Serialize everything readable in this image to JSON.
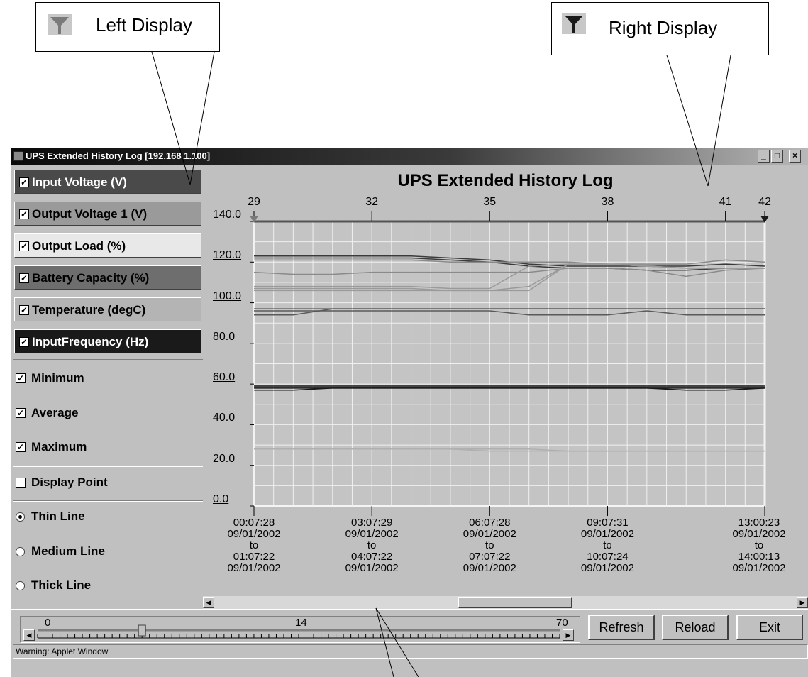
{
  "callouts": {
    "left": "Left Display",
    "right": "Right Display"
  },
  "window": {
    "title": "UPS Extended History Log [192.168.1.100]",
    "controls": {
      "minimize": "_",
      "maximize": "□",
      "close": "×"
    }
  },
  "series_panel": {
    "items": [
      {
        "label": "Input Voltage (V)",
        "checked": true,
        "bg": "#4a4a4a",
        "fg": "#ffffff"
      },
      {
        "label": "Output Voltage 1 (V)",
        "checked": true,
        "bg": "#9a9a9a",
        "fg": "#000000"
      },
      {
        "label": "Output Load (%)",
        "checked": true,
        "bg": "#e8e8e8",
        "fg": "#000000"
      },
      {
        "label": "Battery Capacity (%)",
        "checked": true,
        "bg": "#6e6e6e",
        "fg": "#000000"
      },
      {
        "label": "Temperature (degC)",
        "checked": true,
        "bg": "#b4b4b4",
        "fg": "#000000"
      },
      {
        "label": "InputFrequency (Hz)",
        "checked": true,
        "bg": "#1a1a1a",
        "fg": "#ffffff"
      }
    ],
    "stats": [
      {
        "label": "Minimum",
        "checked": true
      },
      {
        "label": "Average",
        "checked": true
      },
      {
        "label": "Maximum",
        "checked": true
      }
    ],
    "display_point": {
      "label": "Display Point",
      "checked": false
    },
    "line_widths": [
      {
        "label": "Thin Line",
        "selected": true
      },
      {
        "label": "Medium Line",
        "selected": false
      },
      {
        "label": "Thick Line",
        "selected": false
      }
    ]
  },
  "chart_data": {
    "type": "line",
    "title": "UPS Extended History Log",
    "y_ticks": [
      "140.0",
      "120.0",
      "100.0",
      "80.0",
      "60.0",
      "40.0",
      "20.0",
      "0.0"
    ],
    "ylim": [
      0,
      140
    ],
    "top_ticks": [
      "29",
      "32",
      "35",
      "38",
      "41",
      "42"
    ],
    "top_tick_values": [
      29,
      32,
      35,
      38,
      41,
      42
    ],
    "xlim": [
      29,
      42
    ],
    "bottom_labels": [
      {
        "x": 29,
        "lines": [
          "00:07:28",
          "09/01/2002",
          "to",
          "01:07:22",
          "09/01/2002"
        ]
      },
      {
        "x": 32,
        "lines": [
          "03:07:29",
          "09/01/2002",
          "to",
          "04:07:22",
          "09/01/2002"
        ]
      },
      {
        "x": 35,
        "lines": [
          "06:07:28",
          "09/01/2002",
          "to",
          "07:07:22",
          "09/01/2002"
        ]
      },
      {
        "x": 38,
        "lines": [
          "09:07:31",
          "09/01/2002",
          "to",
          "10:07:24",
          "09/01/2002"
        ]
      },
      {
        "x": 42,
        "lines": [
          "13:00:23",
          "09/01/2002",
          "to",
          "14:00:13",
          "09/01/2002"
        ]
      }
    ],
    "x": [
      29,
      30,
      31,
      32,
      33,
      34,
      35,
      36,
      37,
      38,
      39,
      40,
      41,
      42
    ],
    "grid": true,
    "series": [
      {
        "color": "#3a3a3a",
        "values": [
          123,
          123,
          123,
          123,
          123,
          122,
          121,
          119,
          118,
          118,
          118,
          118,
          119,
          118
        ]
      },
      {
        "color": "#3a3a3a",
        "values": [
          122,
          122,
          122,
          122,
          122,
          121,
          120,
          118,
          117,
          117,
          116,
          116,
          117,
          117
        ]
      },
      {
        "color": "#8a8a8a",
        "values": [
          121,
          121,
          121,
          121,
          121,
          120,
          120,
          120,
          120,
          119,
          119,
          119,
          121,
          120
        ]
      },
      {
        "color": "#8a8a8a",
        "values": [
          115,
          114,
          114,
          115,
          115,
          115,
          115,
          115,
          117,
          117,
          116,
          113,
          116,
          117
        ]
      },
      {
        "color": "#9a9a9a",
        "values": [
          108,
          108,
          108,
          108,
          108,
          107,
          107,
          118,
          119,
          119,
          118,
          117,
          117,
          117
        ]
      },
      {
        "color": "#9a9a9a",
        "values": [
          107,
          107,
          107,
          107,
          107,
          106,
          106,
          106,
          119,
          119,
          118,
          117,
          117,
          117
        ]
      },
      {
        "color": "#9a9a9a",
        "values": [
          106,
          106,
          106,
          106,
          106,
          106,
          106,
          108,
          119,
          119,
          118,
          117,
          117,
          117
        ]
      },
      {
        "color": "#5a5a5a",
        "values": [
          97,
          97,
          97,
          97,
          97,
          97,
          97,
          97,
          97,
          97,
          97,
          97,
          97,
          97
        ]
      },
      {
        "color": "#5a5a5a",
        "values": [
          96,
          96,
          96,
          96,
          96,
          96,
          96,
          94,
          94,
          94,
          96,
          94,
          94,
          94
        ]
      },
      {
        "color": "#5a5a5a",
        "values": [
          94,
          94,
          97,
          97,
          97,
          97,
          97,
          97,
          97,
          97,
          97,
          97,
          97,
          97
        ]
      },
      {
        "color": "#1a1a1a",
        "values": [
          59,
          59,
          59,
          59,
          59,
          59,
          59,
          59,
          59,
          59,
          59,
          59,
          59,
          59
        ]
      },
      {
        "color": "#1a1a1a",
        "values": [
          58,
          58,
          58,
          58,
          58,
          58,
          58,
          58,
          58,
          58,
          58,
          58,
          58,
          58
        ]
      },
      {
        "color": "#1a1a1a",
        "values": [
          57,
          57,
          58,
          58,
          58,
          58,
          58,
          58,
          58,
          58,
          58,
          57,
          57,
          58
        ]
      },
      {
        "color": "#b0b0b0",
        "values": [
          28,
          28,
          28,
          28,
          28,
          28,
          28,
          28,
          27,
          27,
          27,
          27,
          27,
          27
        ]
      },
      {
        "color": "#b0b0b0",
        "values": [
          28,
          28,
          28,
          28,
          28,
          28,
          27,
          27,
          27,
          27,
          27,
          27,
          27,
          27
        ]
      }
    ]
  },
  "slider": {
    "min_label": "0",
    "value_label": "14",
    "max_label": "70",
    "min": 0,
    "max": 70,
    "value": 14
  },
  "buttons": {
    "refresh": "Refresh",
    "reload": "Reload",
    "exit": "Exit"
  },
  "status": "Warning: Applet Window"
}
